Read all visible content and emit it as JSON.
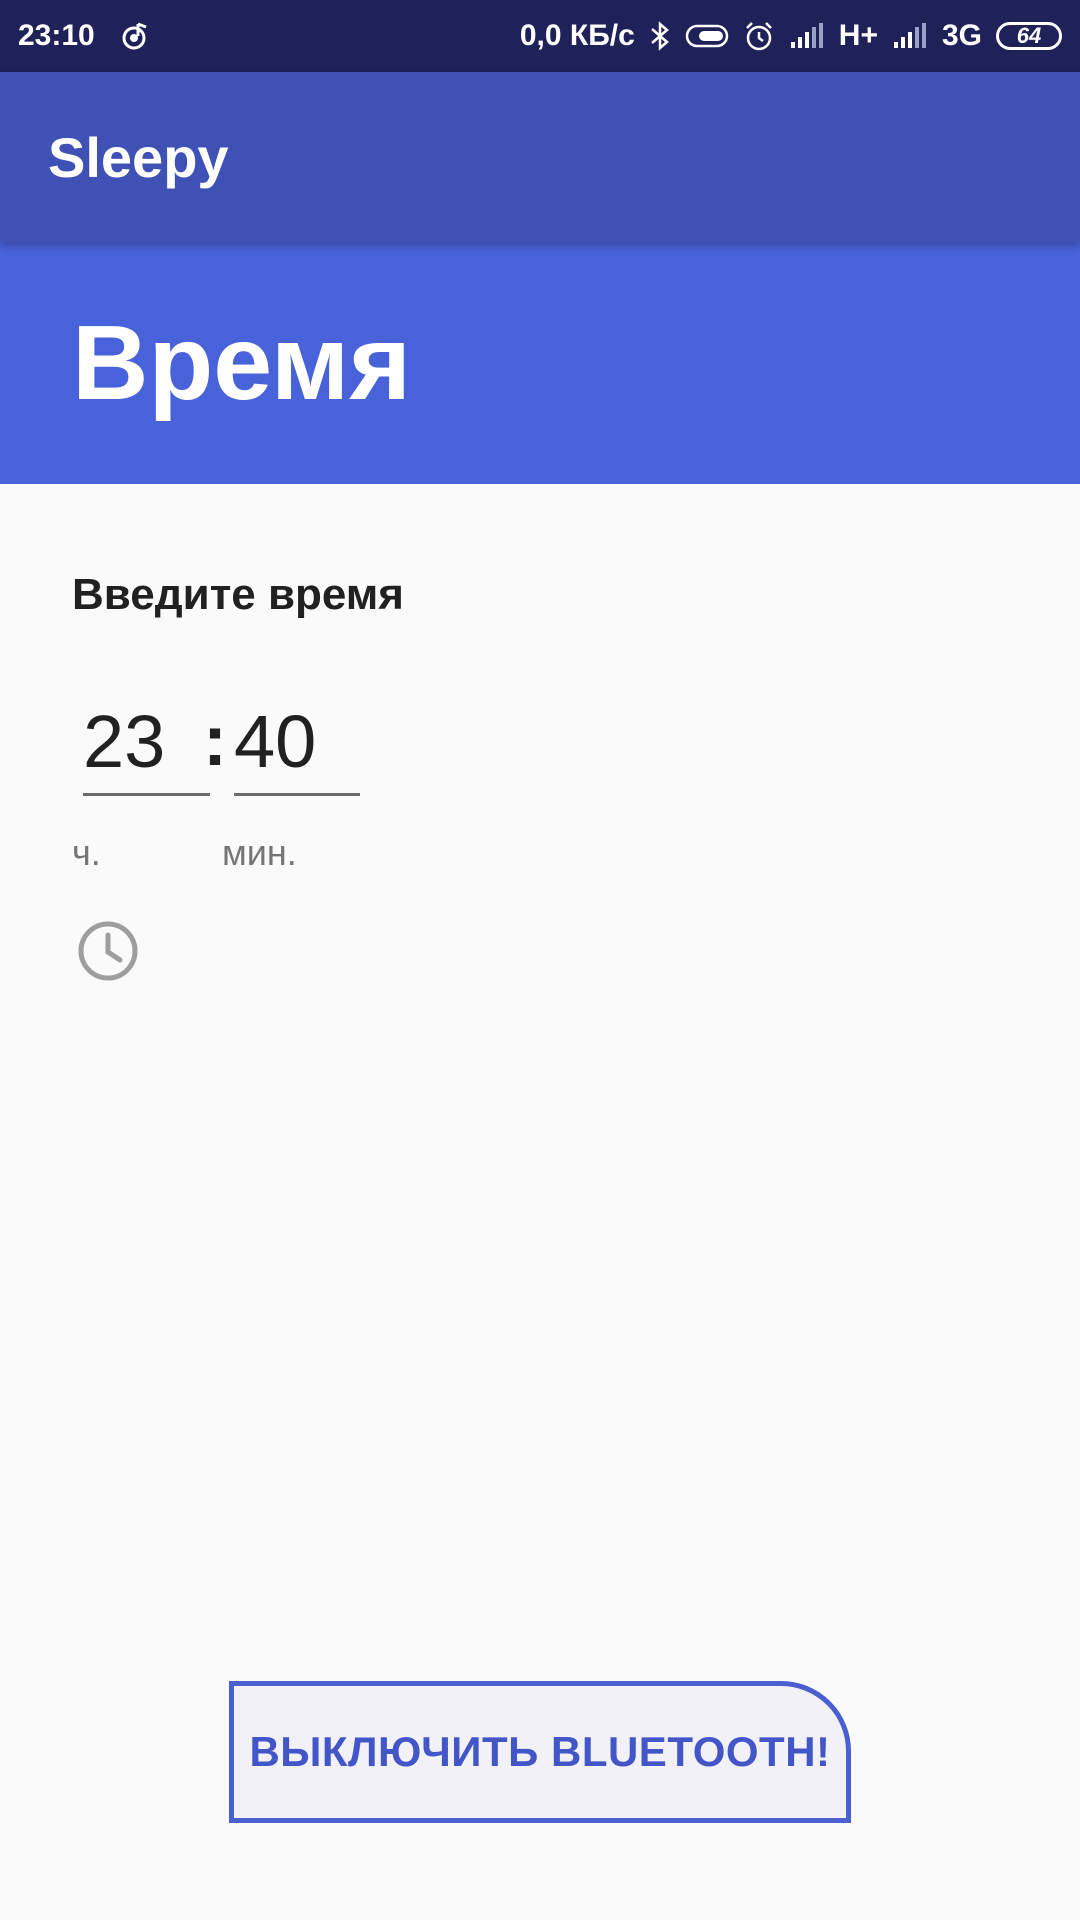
{
  "status_bar": {
    "time": "23:10",
    "speed": "0,0 КБ/с",
    "network1": "H+",
    "network2": "3G",
    "battery": "64",
    "icons": [
      "music-icon",
      "bluetooth-icon",
      "toggle-icon",
      "alarm-icon",
      "signal-icon",
      "signal-icon"
    ]
  },
  "app_bar": {
    "title": "Sleepy"
  },
  "header": {
    "title": "Время"
  },
  "form": {
    "prompt": "Введите время",
    "hours_value": "23",
    "separator": ":",
    "minutes_value": "40",
    "hours_label": "ч.",
    "minutes_label": "мин.",
    "icon": "clock-icon"
  },
  "button": {
    "label": "ВЫКЛЮЧИТЬ BLUETOOTH!"
  },
  "colors": {
    "status_bar": "#1f2258",
    "app_bar": "#3f51b5",
    "header": "#4862d9",
    "accent": "#4a60d0",
    "background": "#fafafa"
  }
}
